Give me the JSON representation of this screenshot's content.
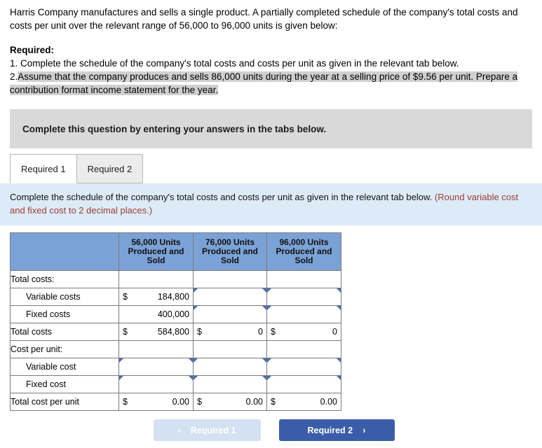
{
  "prompt": {
    "para1": "Harris Company manufactures and sells a single product. A partially completed schedule of the company's total costs and costs per unit over the relevant range of 56,000 to 96,000 units is given below:",
    "required_label": "Required:",
    "item1": "1. Complete the schedule of the company's total costs and costs per unit as given in the relevant tab below.",
    "item2_num": "2.",
    "item2_selected": "Assume that the company produces and sells 86,000 units during the year at a selling price of $9.56 per unit. Prepare a contribution format income statement for the year."
  },
  "banner": {
    "text": "Complete this question by entering your answers in the tabs below."
  },
  "tabs": [
    {
      "label": "Required 1",
      "active": true
    },
    {
      "label": "Required 2",
      "active": false
    }
  ],
  "instruction": {
    "main": "Complete the schedule of the company's total costs and costs per unit as given in the relevant tab below.",
    "note": "(Round variable cost and fixed cost to 2 decimal places.)"
  },
  "table": {
    "corner_header": "",
    "columns": [
      "56,000 Units Produced and Sold",
      "76,000 Units Produced and Sold",
      "96,000 Units Produced and Sold"
    ],
    "rows": [
      {
        "label": "Total costs:",
        "indent": false,
        "cells": [
          {
            "type": "blank"
          },
          {
            "type": "blank"
          },
          {
            "type": "blank"
          }
        ]
      },
      {
        "label": "Variable costs",
        "indent": true,
        "cells": [
          {
            "type": "value",
            "currency": "$",
            "value": "184,800"
          },
          {
            "type": "input"
          },
          {
            "type": "input"
          }
        ]
      },
      {
        "label": "Fixed costs",
        "indent": true,
        "cells": [
          {
            "type": "value",
            "currency": "",
            "value": "400,000"
          },
          {
            "type": "input"
          },
          {
            "type": "input"
          }
        ]
      },
      {
        "label": "Total costs",
        "indent": false,
        "cells": [
          {
            "type": "value",
            "currency": "$",
            "value": "584,800"
          },
          {
            "type": "value",
            "currency": "$",
            "value": "0"
          },
          {
            "type": "value",
            "currency": "$",
            "value": "0"
          }
        ]
      },
      {
        "label": "Cost per unit:",
        "indent": false,
        "cells": [
          {
            "type": "blank"
          },
          {
            "type": "blank"
          },
          {
            "type": "blank"
          }
        ]
      },
      {
        "label": "Variable cost",
        "indent": true,
        "cells": [
          {
            "type": "input"
          },
          {
            "type": "input"
          },
          {
            "type": "input"
          }
        ]
      },
      {
        "label": "Fixed cost",
        "indent": true,
        "cells": [
          {
            "type": "input"
          },
          {
            "type": "input"
          },
          {
            "type": "input"
          }
        ]
      },
      {
        "label": "Total cost per unit",
        "indent": false,
        "cells": [
          {
            "type": "value",
            "currency": "$",
            "value": "0.00"
          },
          {
            "type": "value",
            "currency": "$",
            "value": "0.00"
          },
          {
            "type": "value",
            "currency": "$",
            "value": "0.00"
          }
        ]
      }
    ]
  },
  "nav": {
    "prev_label": "Required 1",
    "prev_chevron": "‹",
    "next_label": "Required 2",
    "next_chevron": "›"
  },
  "colors": {
    "header_blue": "#7ba2d6",
    "instruction_blue": "#dcebf7",
    "note_red": "#9e3b30",
    "banner_gray": "#d9d9d9",
    "input_border": "#4a6fa9",
    "next_button": "#3b5ca8",
    "prev_button": "#d4e1f2",
    "selection_gray": "#d0d0d0"
  }
}
